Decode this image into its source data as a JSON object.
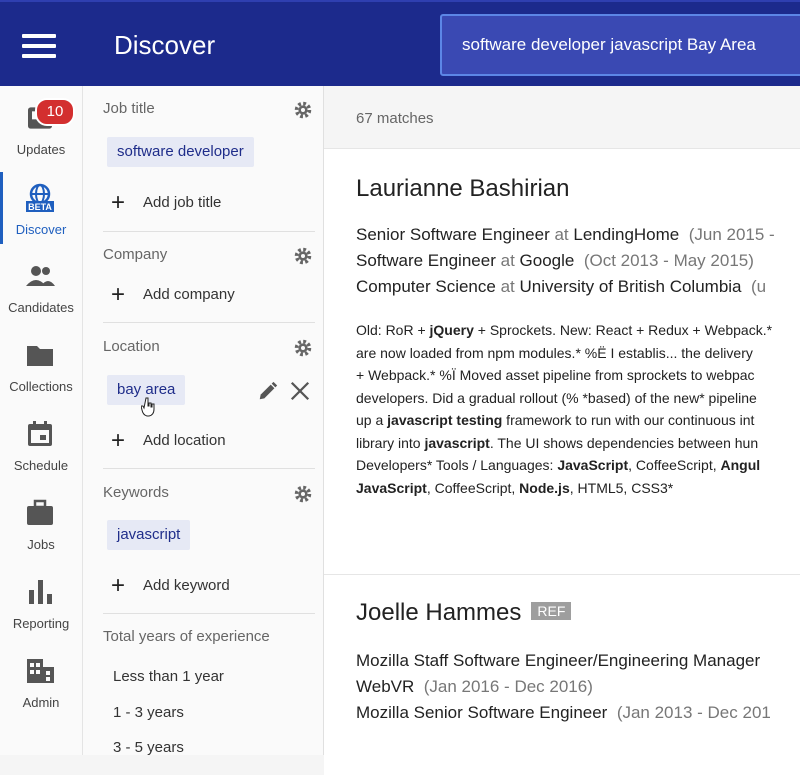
{
  "header": {
    "title": "Discover",
    "search_value": "software developer javascript Bay Area"
  },
  "nav": [
    {
      "label": "Updates",
      "icon": "inbox-icon",
      "badge": "10"
    },
    {
      "label": "Discover",
      "icon": "beta-globe-icon",
      "icon_text": "BETA",
      "active": true
    },
    {
      "label": "Candidates",
      "icon": "people-icon"
    },
    {
      "label": "Collections",
      "icon": "folder-icon"
    },
    {
      "label": "Schedule",
      "icon": "calendar-icon"
    },
    {
      "label": "Jobs",
      "icon": "briefcase-icon"
    },
    {
      "label": "Reporting",
      "icon": "bar-chart-icon"
    },
    {
      "label": "Admin",
      "icon": "building-icon"
    }
  ],
  "filters": {
    "job_title": {
      "label": "Job title",
      "chips": [
        "software developer"
      ],
      "add_label": "Add job title"
    },
    "company": {
      "label": "Company",
      "add_label": "Add company"
    },
    "location": {
      "label": "Location",
      "chips": [
        "bay area"
      ],
      "add_label": "Add location"
    },
    "keywords": {
      "label": "Keywords",
      "chips": [
        "javascript"
      ],
      "add_label": "Add keyword"
    },
    "experience": {
      "label": "Total years of experience",
      "options": [
        "Less than 1 year",
        "1 - 3 years",
        "3 - 5 years"
      ]
    }
  },
  "results": {
    "count_label": "67 matches",
    "candidates": [
      {
        "name": "Laurianne Bashirian",
        "jobs": [
          {
            "title": "Senior Software Engineer",
            "at": "at",
            "org": "LendingHome",
            "dates": "(Jun 2015 -"
          },
          {
            "title": "Software Engineer",
            "at": "at",
            "org": "Google",
            "dates": "(Oct 2013 - May 2015)"
          },
          {
            "title": "Computer Science",
            "at": "at",
            "org": "University of British Columbia",
            "dates": "(u"
          }
        ],
        "snippet_lines": [
          [
            {
              "t": "Old: RoR + "
            },
            {
              "t": "jQuery",
              "b": true
            },
            {
              "t": " + Sprockets. New: React + Redux + Webpack.*"
            }
          ],
          [
            {
              "t": "are now loaded from npm modules.* %Ë I establis... the delivery"
            }
          ],
          [
            {
              "t": "+ Webpack.* %Ï Moved asset pipeline from sprockets to webpac"
            }
          ],
          [
            {
              "t": "developers. Did a gradual rollout (% *based) of the new* pipeline"
            }
          ],
          [
            {
              "t": "up a "
            },
            {
              "t": "javascript testing",
              "b": true
            },
            {
              "t": " framework to run with our continuous int"
            }
          ],
          [
            {
              "t": "library into "
            },
            {
              "t": "javascript",
              "b": true
            },
            {
              "t": ". The UI shows dependencies between hun"
            }
          ],
          [
            {
              "t": "Developers* Tools / Languages: "
            },
            {
              "t": "JavaScript",
              "b": true
            },
            {
              "t": ", CoffeeScript, "
            },
            {
              "t": "Angul",
              "b": true
            }
          ],
          [
            {
              "t": "JavaScript",
              "b": true
            },
            {
              "t": ", CoffeeScript, "
            },
            {
              "t": "Node.js",
              "b": true
            },
            {
              "t": ", HTML5, CSS3*"
            }
          ]
        ]
      },
      {
        "name": "Joelle Hammes",
        "badge": "REF",
        "lines": [
          {
            "text": "Mozilla Staff Software Engineer/Engineering Manager"
          },
          {
            "text": "WebVR",
            "dates": "(Jan 2016 - Dec 2016)"
          },
          {
            "text": "Mozilla Senior Software Engineer",
            "dates": "(Jan 2013 - Dec 201"
          }
        ]
      }
    ]
  },
  "colors": {
    "header_bg": "#1c2a8c",
    "accent": "#1f5fbf",
    "badge": "#d32f2f",
    "chip_bg": "#e6e9f5"
  }
}
